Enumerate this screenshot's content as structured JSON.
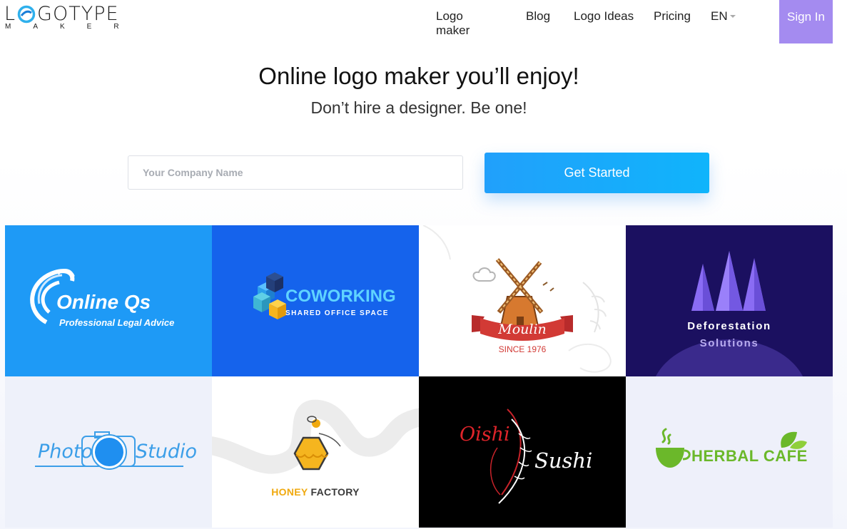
{
  "brand": {
    "logo_prefix": "L",
    "logo_suffix": "GOTYPE",
    "logo_sub": "MAKER"
  },
  "nav": {
    "items": [
      "Logo maker",
      "Blog",
      "Logo Ideas",
      "Pricing"
    ],
    "language": "EN",
    "sign_in": "Sign In"
  },
  "hero": {
    "title": "Online logo maker you’ll enjoy!",
    "subtitle": "Don’t hire a designer. Be one!",
    "input_placeholder": "Your Company Name",
    "cta": "Get Started"
  },
  "logos": [
    {
      "name": "Online Qs",
      "tagline": "Professional Legal Advice",
      "bg": "#1e9af6"
    },
    {
      "name": "COWORKING",
      "tagline": "SHARED OFFICE SPACE",
      "bg": "#1563ec"
    },
    {
      "name": "Moulin",
      "tagline": "SINCE 1976",
      "bg": "#ffffff"
    },
    {
      "name": "Deforestation",
      "tagline": "Solutions",
      "bg": "#1b1060"
    },
    {
      "name": "Photo",
      "tagline": "Studio",
      "bg": "#eef1fa"
    },
    {
      "name": "HONEY",
      "tagline": "FACTORY",
      "bg": "#ffffff"
    },
    {
      "name": "Oishi",
      "tagline": "Sushi",
      "bg": "#000000"
    },
    {
      "name": "HERBAL CAFE",
      "tagline": "",
      "bg": "#eef0fa"
    }
  ],
  "colors": {
    "accent": "#21a0fb",
    "sign_in_bg": "#a48bf0"
  }
}
